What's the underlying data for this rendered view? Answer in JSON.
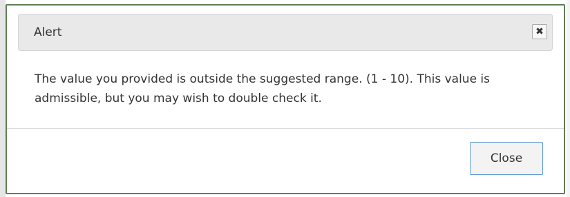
{
  "dialog": {
    "title": "Alert",
    "close_icon_name": "close-icon",
    "message": "The value you provided is outside the suggested range. (1 - 10). This value is admissible, but you may wish to double check it.",
    "close_button_label": "Close"
  }
}
